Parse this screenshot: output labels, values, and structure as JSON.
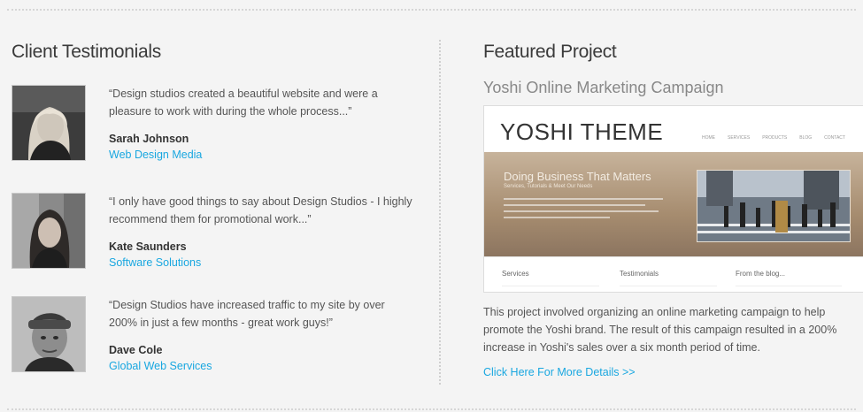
{
  "testimonials": {
    "heading": "Client Testimonials",
    "items": [
      {
        "quote": "“Design studios created a beautiful website and were a pleasure to work with during the whole process...”",
        "name": "Sarah Johnson",
        "company": "Web Design Media"
      },
      {
        "quote": "“I only have good things to say about Design Studios - I highly recommend them for promotional work...”",
        "name": "Kate Saunders",
        "company": "Software Solutions"
      },
      {
        "quote": "“Design Studios have increased traffic to my site by over 200% in just a few months - great work guys!”",
        "name": "Dave Cole",
        "company": "Global Web Services"
      }
    ]
  },
  "featured": {
    "heading": "Featured Project",
    "project_title": "Yoshi Online Marketing Campaign",
    "preview": {
      "logo": "YOSHI THEME",
      "nav": [
        "HOME",
        "SERVICES",
        "PRODUCTS",
        "BLOG",
        "CONTACT"
      ],
      "banner_headline": "Doing Business That Matters",
      "banner_sub": "Services, Tutorials & Meet Our Needs",
      "footer_columns": [
        "Services",
        "Testimonials",
        "From the blog..."
      ]
    },
    "description": "This project involved organizing an online marketing campaign to help promote the Yoshi brand. The result of this campaign resulted in a 200% increase in Yoshi's sales over a six month period of time.",
    "link": "Click Here For More Details >>"
  },
  "colors": {
    "background": "#f4f4f4",
    "link": "#19a7e0",
    "heading": "#3a3a3a",
    "subheading": "#888888"
  }
}
